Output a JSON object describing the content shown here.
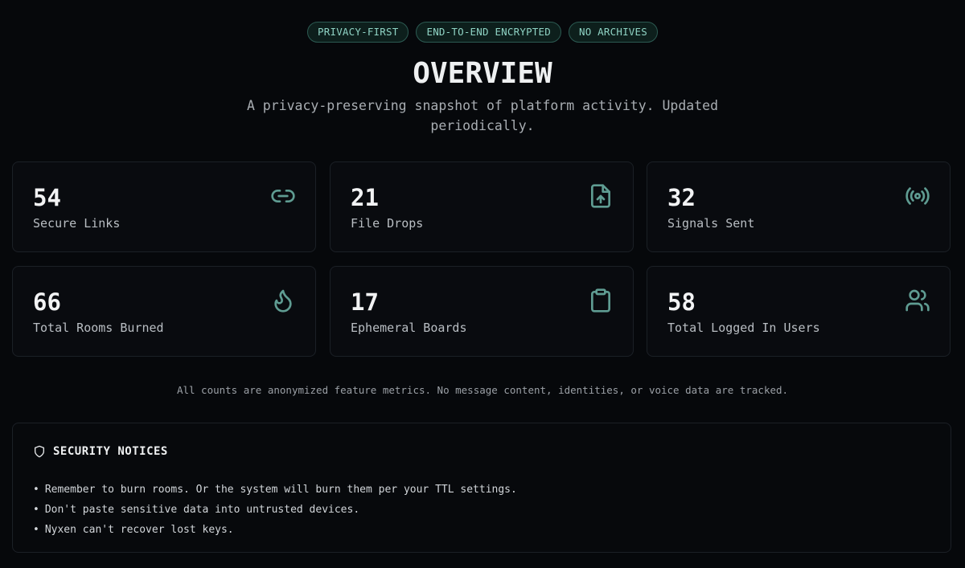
{
  "badges": [
    "PRIVACY-FIRST",
    "END-TO-END ENCRYPTED",
    "NO ARCHIVES"
  ],
  "header": {
    "title": "OVERVIEW",
    "subtitle": "A privacy-preserving snapshot of platform activity. Updated periodically."
  },
  "stats": [
    {
      "value": "54",
      "label": "Secure Links",
      "icon": "link-icon"
    },
    {
      "value": "21",
      "label": "File Drops",
      "icon": "file-upload-icon"
    },
    {
      "value": "32",
      "label": "Signals Sent",
      "icon": "broadcast-icon"
    },
    {
      "value": "66",
      "label": "Total Rooms Burned",
      "icon": "flame-icon"
    },
    {
      "value": "17",
      "label": "Ephemeral Boards",
      "icon": "clipboard-icon"
    },
    {
      "value": "58",
      "label": "Total Logged In Users",
      "icon": "users-icon"
    }
  ],
  "note": "All counts are anonymized feature metrics. No message content, identities, or voice data are tracked.",
  "notices": {
    "title": "SECURITY NOTICES",
    "icon": "shield-icon",
    "items": [
      "Remember to burn rooms. Or the system will burn them per your TTL settings.",
      "Don't paste sensitive data into untrusted devices.",
      "Nyxen can't recover lost keys."
    ]
  },
  "colors": {
    "background": "#06080b",
    "accent": "#5f9c92",
    "badge_text": "#8fd3c4",
    "card_border": "#1b2026"
  }
}
